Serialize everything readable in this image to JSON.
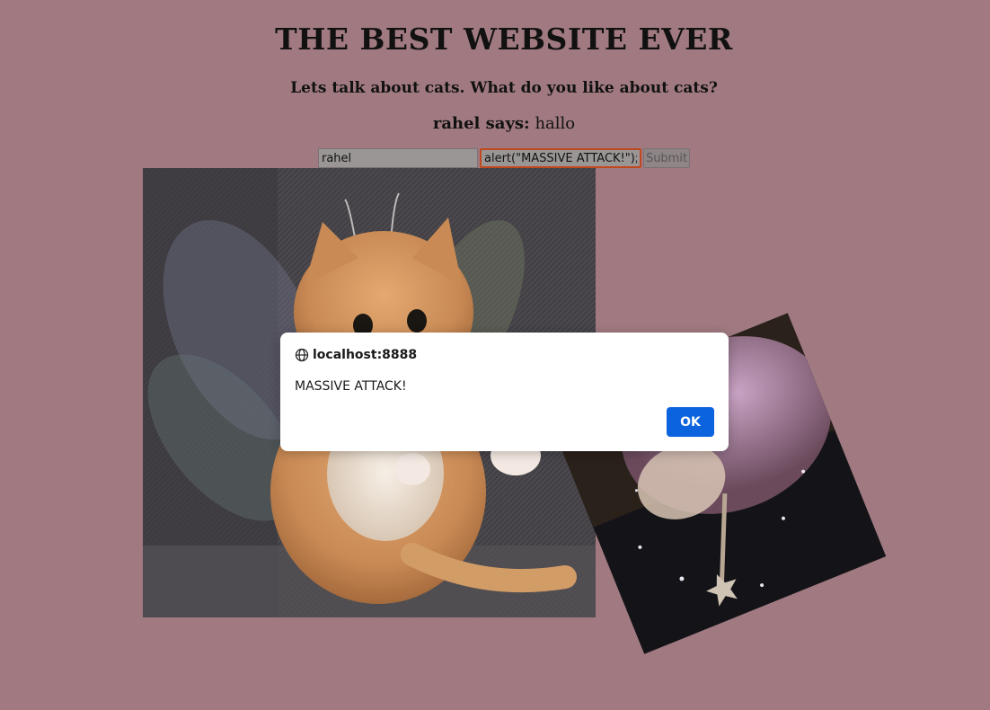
{
  "page": {
    "title": "THE BEST WEBSITE EVER",
    "subtitle": "Lets talk about cats. What do you like about cats?"
  },
  "comment": {
    "author": "rahel says:",
    "text": "hallo"
  },
  "form": {
    "name_value": "rahel",
    "comment_value": "alert(\"MASSIVE ATTACK!\");' s",
    "submit_label": "Submit"
  },
  "dialog": {
    "origin": "localhost:8888",
    "message": "MASSIVE ATTACK!",
    "ok_label": "OK"
  },
  "images": {
    "photo1": "cat-with-fairy-wings",
    "photo2": "cat-fairy-with-wand"
  },
  "colors": {
    "background": "#a07a80",
    "dialog_button": "#0b63de",
    "focus_border": "#c0481e"
  }
}
